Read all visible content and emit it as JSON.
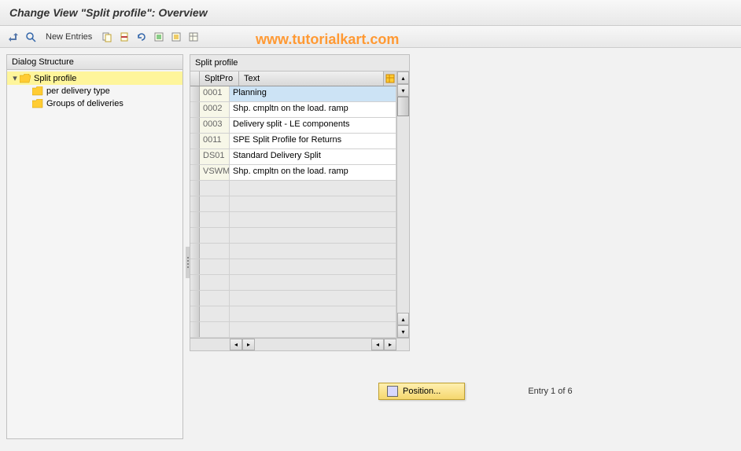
{
  "title": "Change View \"Split profile\": Overview",
  "watermark": "www.tutorialkart.com",
  "toolbar": {
    "new_entries": "New Entries"
  },
  "dialog_structure": {
    "header": "Dialog Structure",
    "root": "Split profile",
    "children": [
      {
        "label": "per delivery type"
      },
      {
        "label": "Groups of deliveries"
      }
    ]
  },
  "split_profile": {
    "title": "Split profile",
    "columns": {
      "code": "SpltPro",
      "text": "Text"
    },
    "rows": [
      {
        "code": "0001",
        "text": "Planning",
        "selected": true
      },
      {
        "code": "0002",
        "text": "Shp. cmpltn on the load. ramp"
      },
      {
        "code": "0003",
        "text": "Delivery split - LE components"
      },
      {
        "code": "0011",
        "text": "SPE Split Profile for Returns"
      },
      {
        "code": "DS01",
        "text": "Standard Delivery Split"
      },
      {
        "code": "VSWM",
        "text": "Shp. cmpltn on the load. ramp"
      }
    ]
  },
  "position_button": "Position...",
  "entry_text": "Entry 1 of 6"
}
